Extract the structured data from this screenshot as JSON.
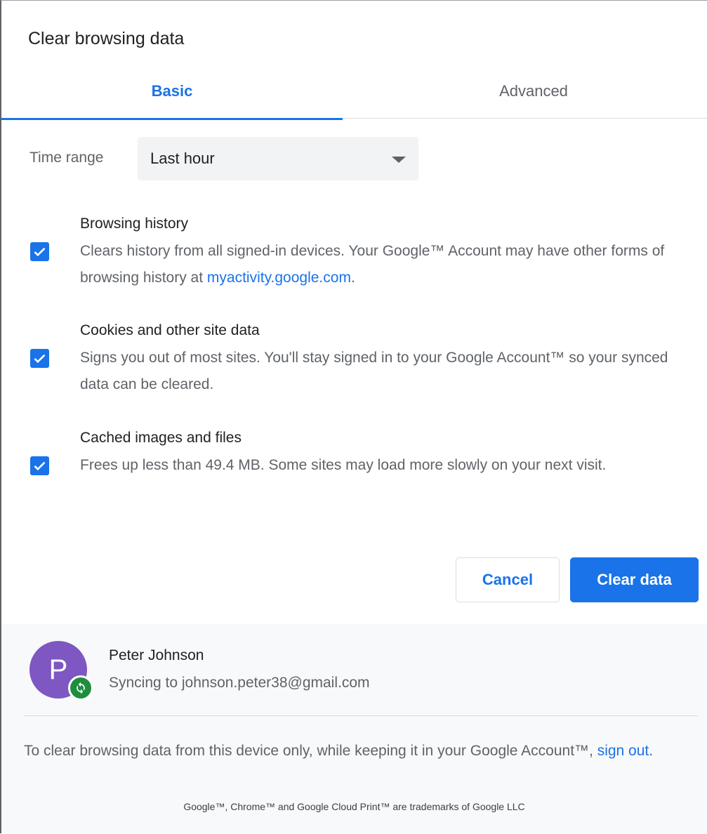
{
  "dialog": {
    "title": "Clear browsing data",
    "tabs": [
      {
        "label": "Basic",
        "selected": true
      },
      {
        "label": "Advanced",
        "selected": false
      }
    ]
  },
  "time_range": {
    "label": "Time range",
    "selected": "Last hour"
  },
  "items": [
    {
      "title": "Browsing history",
      "checked": true,
      "desc_before": "Clears history from all signed-in devices. Your Google™ Account may have other forms of browsing history at ",
      "link": "myactivity.google.com",
      "desc_after": "."
    },
    {
      "title": "Cookies and other site data",
      "checked": true,
      "desc": "Signs you out of most sites. You'll stay signed in to your Google Account™ so your synced data can be cleared."
    },
    {
      "title": "Cached images and files",
      "checked": true,
      "desc": "Frees up less than 49.4 MB. Some sites may load more slowly on your next visit."
    }
  ],
  "buttons": {
    "cancel": "Cancel",
    "clear": "Clear data"
  },
  "account": {
    "avatar_letter": "P",
    "name": "Peter Johnson",
    "sync_text": "Syncing to johnson.peter38@gmail.com"
  },
  "footer": {
    "info_before": "To clear browsing data from this device only, while keeping it in your Google Account™, ",
    "sign_out": "sign out",
    "info_after": ".",
    "trademark": "Google™, Chrome™ and Google Cloud Print™ are trademarks of Google LLC"
  },
  "colors": {
    "accent": "#1a73e8",
    "avatar": "#7e57c2",
    "sync_badge": "#1e8e3e"
  }
}
